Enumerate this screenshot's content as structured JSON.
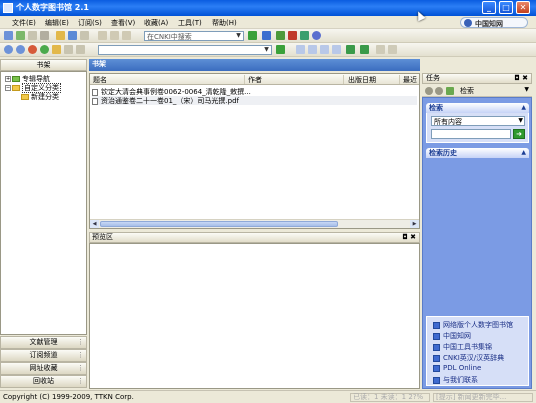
{
  "window": {
    "title": "个人数字图书馆 2.1"
  },
  "menu": [
    "文件(E)",
    "编辑(E)",
    "订阅(S)",
    "查看(V)",
    "收藏(A)",
    "工具(T)",
    "帮助(H)"
  ],
  "brand": {
    "label": "中国知网"
  },
  "toolbar": {
    "search_scope": "在CNKI中搜索",
    "address_value": ""
  },
  "left_panel": {
    "header": "书架",
    "tree": [
      {
        "label": "专辑导航",
        "level": 0
      },
      {
        "label": "自定义分类",
        "level": 0,
        "selected": true
      },
      {
        "label": "新建分类",
        "level": 1
      }
    ],
    "nav_buttons": [
      "文献管理",
      "订阅频道",
      "网址收藏",
      "回收站"
    ]
  },
  "bookshelf": {
    "header": "书架",
    "columns": [
      "题名",
      "作者",
      "出版日期",
      "最近"
    ],
    "rows": [
      {
        "title": "钦定大清会典事例卷0062-0064_清乾隆_敕撰..."
      },
      {
        "title": "资治通鉴卷二十一卷01_（宋）司马光撰.pdf"
      }
    ]
  },
  "preview": {
    "header": "预览区",
    "controls": "◘ ✖"
  },
  "task_panel": {
    "header": "任务",
    "controls": "◘ ✖",
    "subtitle": "检索",
    "search_group": {
      "title": "检索",
      "scope": "所有内容",
      "query": ""
    },
    "history_group": {
      "title": "检索历史"
    },
    "links": [
      "网络版个人数字图书馆",
      "中国知网",
      "中国工具书集锦",
      "CNKI英汉/汉英辞典",
      "PDL Online",
      "与我们联系"
    ]
  },
  "status": {
    "copyright": "Copyright (C) 1999-2009, TTKN Corp.",
    "mid": "已读：1 未读：1 2?%",
    "right": "[提示] 新闻更新完毕..."
  }
}
